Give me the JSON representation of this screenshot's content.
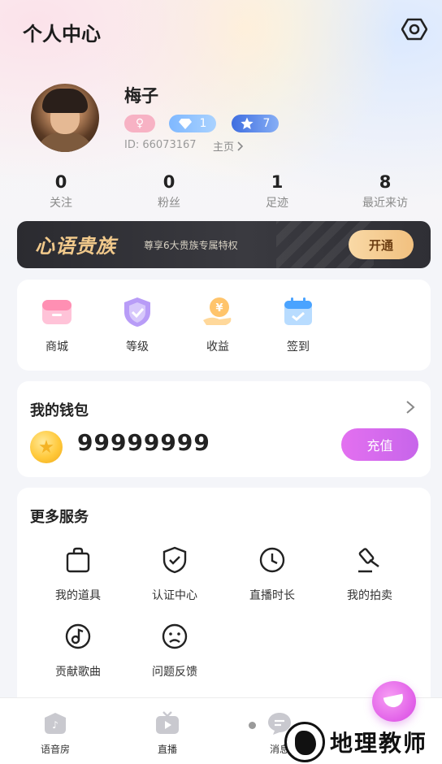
{
  "header": {
    "title": "个人中心",
    "settings_icon": "settings-hex-icon"
  },
  "profile": {
    "name": "梅子",
    "gender_symbol": "♀",
    "diamond_level": "1",
    "star_level": "7",
    "id_text": "ID: 66073167",
    "home_link": "主页"
  },
  "stats": [
    {
      "value": "0",
      "label": "关注"
    },
    {
      "value": "0",
      "label": "粉丝"
    },
    {
      "value": "1",
      "label": "足迹"
    },
    {
      "value": "8",
      "label": "最近来访"
    }
  ],
  "vip": {
    "title": "心语贵族",
    "desc": "尊享6大贵族专属特权",
    "button": "开通"
  },
  "quick": [
    {
      "label": "商城",
      "icon": "shop-icon"
    },
    {
      "label": "等级",
      "icon": "level-shield-icon"
    },
    {
      "label": "收益",
      "icon": "income-coin-icon"
    },
    {
      "label": "签到",
      "icon": "checkin-calendar-icon"
    }
  ],
  "wallet": {
    "title": "我的钱包",
    "balance": "99999999",
    "recharge": "充值"
  },
  "services": {
    "title": "更多服务",
    "items": [
      {
        "label": "我的道具",
        "icon": "bag-icon"
      },
      {
        "label": "认证中心",
        "icon": "verified-shield-icon"
      },
      {
        "label": "直播时长",
        "icon": "clock-icon"
      },
      {
        "label": "我的拍卖",
        "icon": "gavel-icon"
      },
      {
        "label": "贡献歌曲",
        "icon": "music-disc-icon"
      },
      {
        "label": "问题反馈",
        "icon": "feedback-face-icon"
      }
    ]
  },
  "tabs": [
    {
      "label": "语音房",
      "icon": "voice-room-icon"
    },
    {
      "label": "直播",
      "icon": "tv-icon"
    },
    {
      "label": "消息",
      "icon": "message-icon"
    }
  ],
  "watermark": "地理教师",
  "colors": {
    "accent": "#e15fe8",
    "vip_gold": "#f1c98b",
    "vip_bg": "#2b2b30"
  }
}
